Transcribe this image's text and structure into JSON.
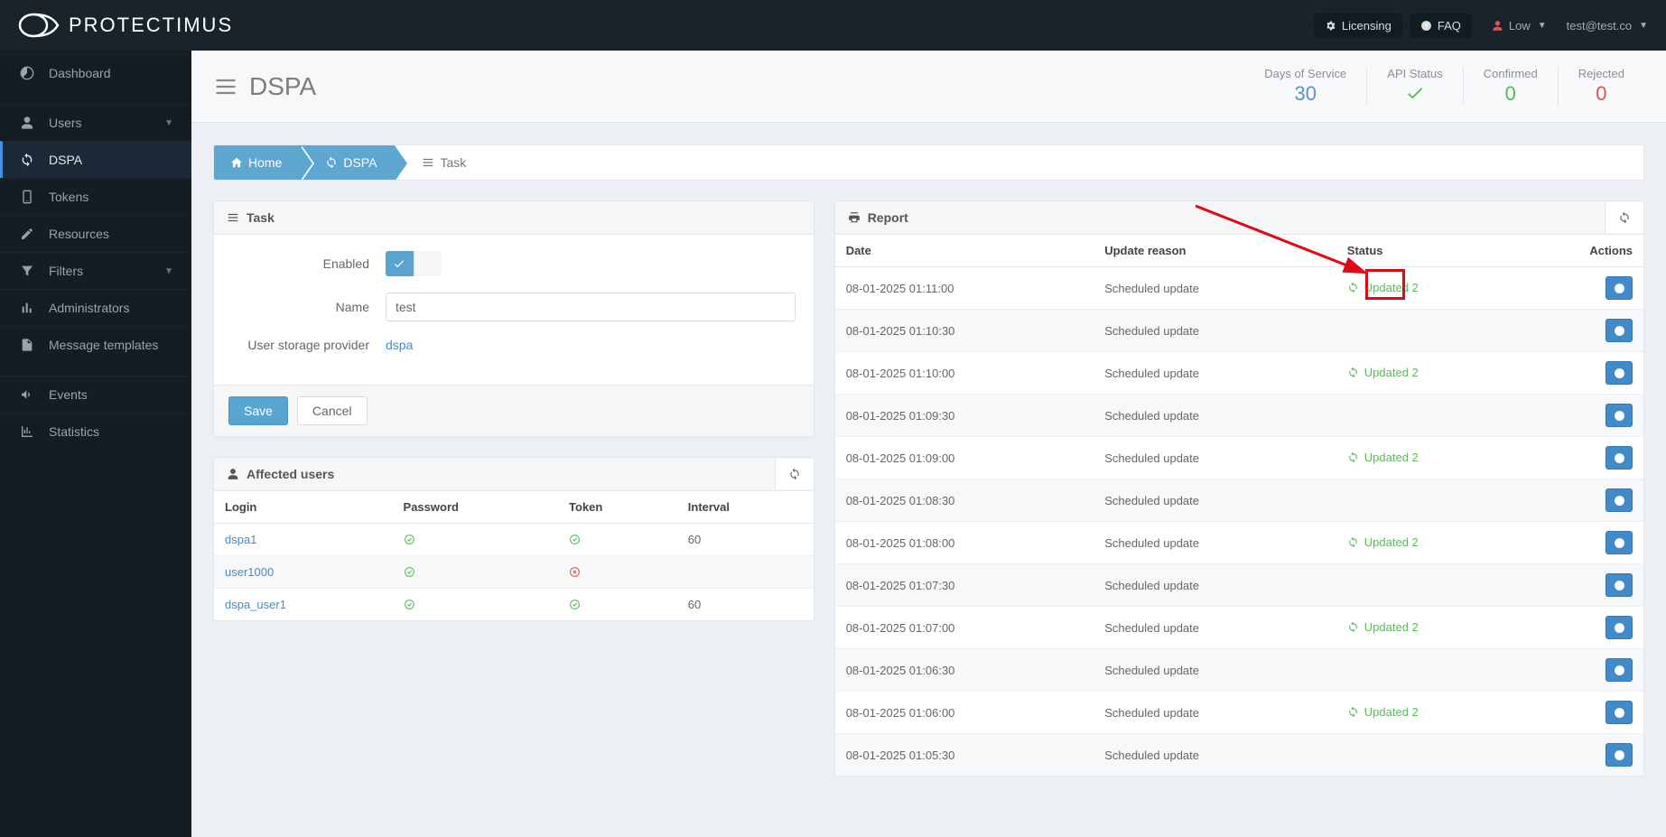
{
  "brand": "PROTECTIMUS",
  "topbar": {
    "licensing": "Licensing",
    "faq": "FAQ",
    "level": "Low",
    "user": "test@test.co"
  },
  "sidebar": {
    "items": [
      {
        "label": "Dashboard",
        "icon": "dashboard"
      },
      {
        "label": "Users",
        "icon": "user",
        "caret": true
      },
      {
        "label": "DSPA",
        "icon": "sync",
        "active": true
      },
      {
        "label": "Tokens",
        "icon": "mobile"
      },
      {
        "label": "Resources",
        "icon": "edit"
      },
      {
        "label": "Filters",
        "icon": "filter",
        "caret": true
      },
      {
        "label": "Administrators",
        "icon": "bars"
      },
      {
        "label": "Message templates",
        "icon": "file"
      },
      {
        "label": "Events",
        "icon": "megaphone"
      },
      {
        "label": "Statistics",
        "icon": "chart"
      }
    ]
  },
  "page": {
    "title": "DSPA"
  },
  "stats": {
    "days_label": "Days of Service",
    "days_val": "30",
    "api_label": "API Status",
    "api_ok": true,
    "confirmed_label": "Confirmed",
    "confirmed_val": "0",
    "rejected_label": "Rejected",
    "rejected_val": "0"
  },
  "breadcrumb": {
    "home": "Home",
    "dspa": "DSPA",
    "task": "Task"
  },
  "task_panel": {
    "title": "Task",
    "enabled_label": "Enabled",
    "name_label": "Name",
    "name_value": "test",
    "usp_label": "User storage provider",
    "usp_value": "dspa",
    "save": "Save",
    "cancel": "Cancel"
  },
  "affected_panel": {
    "title": "Affected users",
    "cols": {
      "login": "Login",
      "password": "Password",
      "token": "Token",
      "interval": "Interval"
    },
    "rows": [
      {
        "login": "dspa1",
        "password": true,
        "token": true,
        "interval": "60"
      },
      {
        "login": "user1000",
        "password": true,
        "token": false,
        "interval": ""
      },
      {
        "login": "dspa_user1",
        "password": true,
        "token": true,
        "interval": "60"
      }
    ]
  },
  "report_panel": {
    "title": "Report",
    "cols": {
      "date": "Date",
      "reason": "Update reason",
      "status": "Status",
      "actions": "Actions"
    },
    "status_text": "Updated 2",
    "rows": [
      {
        "date": "08-01-2025 01:11:00",
        "reason": "Scheduled update",
        "status": true
      },
      {
        "date": "08-01-2025 01:10:30",
        "reason": "Scheduled update",
        "status": false
      },
      {
        "date": "08-01-2025 01:10:00",
        "reason": "Scheduled update",
        "status": true
      },
      {
        "date": "08-01-2025 01:09:30",
        "reason": "Scheduled update",
        "status": false
      },
      {
        "date": "08-01-2025 01:09:00",
        "reason": "Scheduled update",
        "status": true
      },
      {
        "date": "08-01-2025 01:08:30",
        "reason": "Scheduled update",
        "status": false
      },
      {
        "date": "08-01-2025 01:08:00",
        "reason": "Scheduled update",
        "status": true
      },
      {
        "date": "08-01-2025 01:07:30",
        "reason": "Scheduled update",
        "status": false
      },
      {
        "date": "08-01-2025 01:07:00",
        "reason": "Scheduled update",
        "status": true
      },
      {
        "date": "08-01-2025 01:06:30",
        "reason": "Scheduled update",
        "status": false
      },
      {
        "date": "08-01-2025 01:06:00",
        "reason": "Scheduled update",
        "status": true
      },
      {
        "date": "08-01-2025 01:05:30",
        "reason": "Scheduled update",
        "status": false
      }
    ]
  }
}
